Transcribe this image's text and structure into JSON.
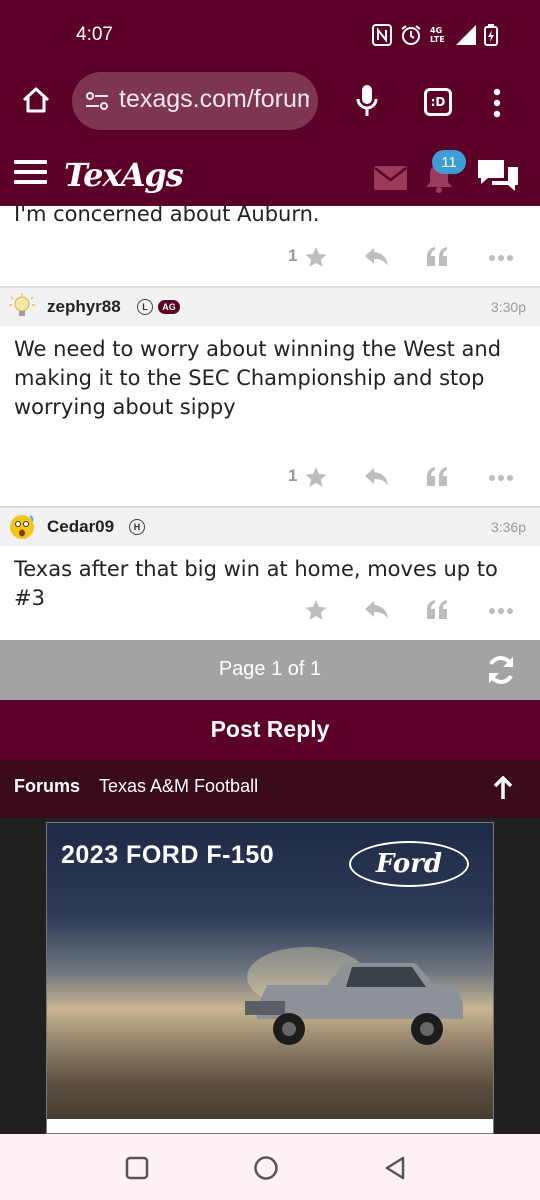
{
  "status": {
    "time": "4:07",
    "network": "4G LTE"
  },
  "browser": {
    "url": "texags.com/forums"
  },
  "site": {
    "logo": "TexAgs",
    "notification_count": "11"
  },
  "posts": [
    {
      "text": "I'm concerned about Auburn.",
      "likes": "1"
    },
    {
      "username": "zephyr88",
      "badge_l": "L",
      "badge_ag": "AG",
      "time": "3:30p",
      "text": "We need to worry about winning the West and making it to the SEC Championship and stop worrying about sippy",
      "likes": "1"
    },
    {
      "username": "Cedar09",
      "badge_h": "H",
      "time": "3:36p",
      "text": "Texas after that big win at home, moves up to #3",
      "likes": ""
    }
  ],
  "pagination": {
    "label": "Page 1 of 1"
  },
  "reply": {
    "label": "Post Reply"
  },
  "breadcrumb": {
    "forums": "Forums",
    "board": "Texas A&M Football"
  },
  "ad": {
    "headline": "2023 FORD F-150",
    "brand": "Ford"
  },
  "colors": {
    "brand": "#5c0128",
    "accent": "#3b9fd6",
    "page_bar": "#a3a3a3"
  }
}
